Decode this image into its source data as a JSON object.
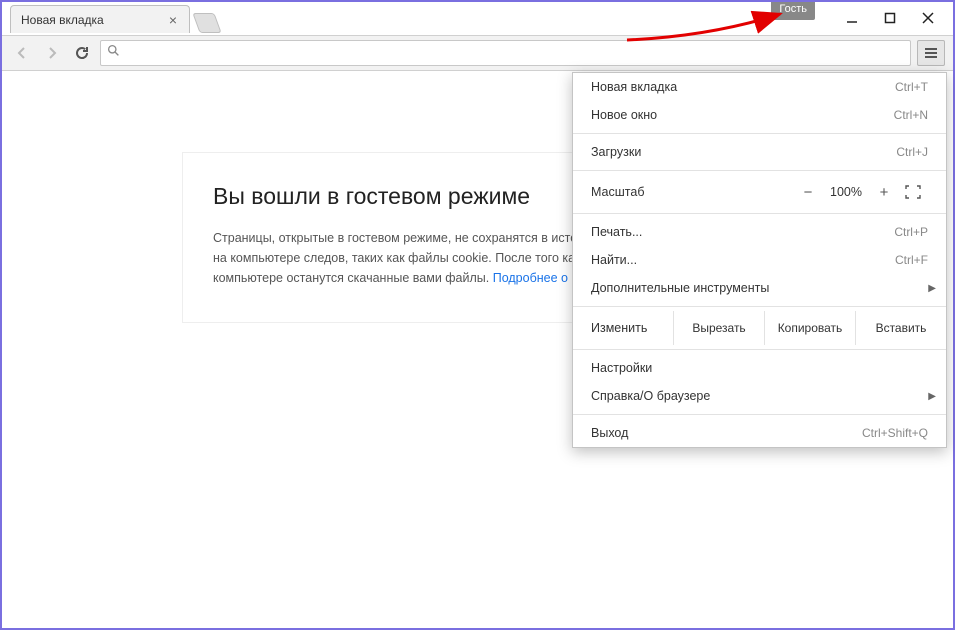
{
  "titlebar": {
    "tab_title": "Новая вкладка",
    "guest_badge": "Гость"
  },
  "content": {
    "heading": "Вы вошли в гостевом режиме",
    "body_prefix": "Страницы, открытые в гостевом режиме, не сохранятся в истории браузера и не оставят на компьютере следов, таких как файлы cookie. После того как вы выйдете, на компьютере останутся скачанные вами файлы. ",
    "link_text": "Подробнее о гостевом режиме..."
  },
  "menu": {
    "new_tab": "Новая вкладка",
    "new_tab_sc": "Ctrl+T",
    "new_window": "Новое окно",
    "new_window_sc": "Ctrl+N",
    "downloads": "Загрузки",
    "downloads_sc": "Ctrl+J",
    "zoom_label": "Масштаб",
    "zoom_minus": "−",
    "zoom_value": "100%",
    "zoom_plus": "+",
    "print": "Печать...",
    "print_sc": "Ctrl+P",
    "find": "Найти...",
    "find_sc": "Ctrl+F",
    "more_tools": "Дополнительные инструменты",
    "edit_label": "Изменить",
    "cut": "Вырезать",
    "copy": "Копировать",
    "paste": "Вставить",
    "settings": "Настройки",
    "help": "Справка/О браузере",
    "exit": "Выход",
    "exit_sc": "Ctrl+Shift+Q"
  }
}
